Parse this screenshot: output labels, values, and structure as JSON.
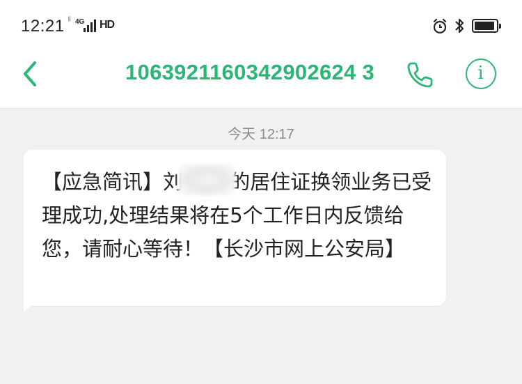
{
  "status_bar": {
    "time": "12:21",
    "network_type": "4G",
    "hd_badge": "HD",
    "icons": [
      "signal-icon",
      "alarm-icon",
      "bluetooth-icon",
      "battery-icon"
    ]
  },
  "header": {
    "title": "1063921160342902624 3",
    "icons": [
      "back-arrow-icon",
      "phone-icon",
      "info-icon"
    ],
    "info_glyph": "i",
    "accent_color": "#2bb673"
  },
  "messages": {
    "timestamp": "今天 12:17",
    "items": [
      {
        "text": "【应急简讯】刘**,您的居住证换领业务已受理成功,处理结果将在5个工作日内反馈给您，请耐心等待！【长沙市网上公安局】"
      }
    ]
  }
}
